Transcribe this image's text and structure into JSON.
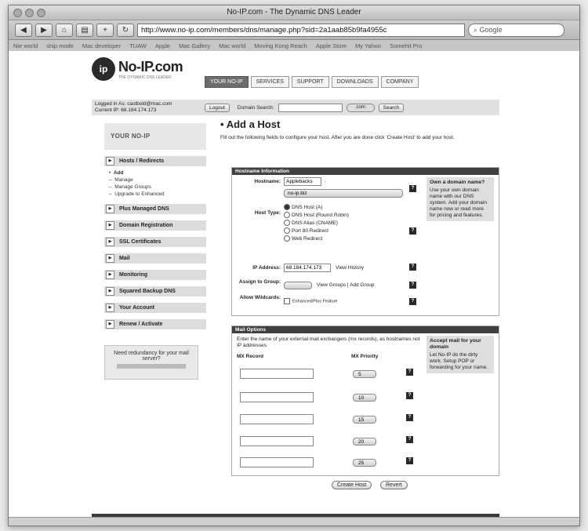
{
  "window": {
    "title": "No-IP.com - The Dynamic DNS Leader"
  },
  "toolbar": {
    "url": "http://www.no-ip.com/members/dns/manage.php?sid=2a1aab85b9fa4955c",
    "search_placeholder": "Google"
  },
  "bookmarks": [
    "Nie world",
    "ship mode",
    "Mac developer",
    "TUAW",
    "Apple",
    "Mac Gallery",
    "Mac world",
    "Moving Kong Reach",
    "Apple Store",
    "My Yahoo",
    "Somehit Pro"
  ],
  "site": {
    "logo_text": "No-IP.com",
    "logo_tagline": "THE DYNAMIC DNS LEADER",
    "tabs": [
      "YOUR NO-IP",
      "SERVICES",
      "SUPPORT",
      "DOWNLOADS",
      "COMPANY"
    ],
    "login_line": "Logged in As: castbold@mac.com",
    "current_ip": "Current IP: 68.184.174.173",
    "logout_label": "Logout",
    "domain_search_label": "Domain Search:",
    "domain_ext": ".com",
    "search_button": "Search"
  },
  "sidebar": {
    "heading": "YOUR NO-IP",
    "sections": [
      "Hosts / Redirects",
      "Plus Managed DNS",
      "Domain Registration",
      "SSL Certificates",
      "Mail",
      "Monitoring",
      "Squared Backup DNS",
      "Your Account",
      "Renew / Activate"
    ],
    "subitems": [
      "Add",
      "Manage",
      "Manage Groups",
      "Upgrade to Enhanced"
    ],
    "promo_text": "Need redundancy for your mail server?"
  },
  "content": {
    "title": "Add a Host",
    "intro": "Fill out the following fields to configure your host. After you are done click 'Create Host' to add your host.",
    "hostname_panel": {
      "header": "Hostname Information",
      "hostname_label": "Hostname:",
      "hostname_value": "Applebacks",
      "domain_value": "no-ip.biz",
      "host_type_label": "Host Type:",
      "host_types": [
        "DNS Host (A)",
        "DNS Host (Round Robin)",
        "DNS Alias (CNAME)",
        "Port 80 Redirect",
        "Web Redirect"
      ],
      "ip_label": "IP Address:",
      "ip_value": "68.184.174.173",
      "view_history": "View History",
      "assign_label": "Assign to Group:",
      "view_groups": "View Groups",
      "add_group": "Add Group",
      "allow_wildcards_label": "Allow Wildcards:",
      "wildcards_note": "Enhanced/Plus Feature",
      "sidebox_title": "Own a domain name?",
      "sidebox_text": "Use your own domain name with our DNS system. Add your domain name now or read more for pricing and features."
    },
    "mail_panel": {
      "header": "Mail Options",
      "intro": "Enter the name of your external mail exchangers (mx records), as hostnames not IP addresses.",
      "mx_record_label": "MX Record",
      "mx_priority_label": "MX Priority",
      "priorities": [
        "5",
        "10",
        "15",
        "20",
        "25"
      ],
      "sidebox_title": "Accept mail for your domain",
      "sidebox_text": "Let No-IP do the dirty work. Setup POP or forwarding for your name."
    },
    "create_button": "Create Host",
    "revert_button": "Revert",
    "separator": "|"
  }
}
